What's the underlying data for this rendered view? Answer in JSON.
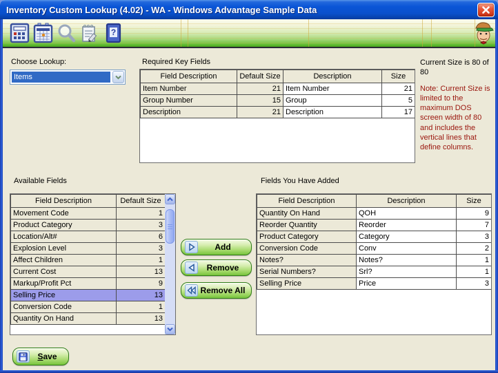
{
  "window": {
    "title": "Inventory Custom Lookup (4.02) - WA - Windows Advantage Sample Data"
  },
  "toolbar": {
    "icons": [
      "calculator",
      "calendar",
      "search",
      "notes",
      "help"
    ],
    "advisor": "advisor-character"
  },
  "lookup": {
    "label": "Choose Lookup:",
    "selected_value": "Items"
  },
  "required_fields": {
    "title": "Required Key Fields",
    "headers": [
      "Field Description",
      "Default Size",
      "Description",
      "Size"
    ],
    "rows": [
      [
        "Item Number",
        "21",
        "Item Number",
        "21"
      ],
      [
        "Group Number",
        "15",
        "Group",
        "5"
      ],
      [
        "Description",
        "21",
        "Description",
        "17"
      ]
    ]
  },
  "current_size": {
    "text": "Current Size is 80 of 80",
    "note": "Note:  Current Size is limited to the maximum DOS screen width of 80 and includes the vertical lines that define columns."
  },
  "available_fields": {
    "title": "Available Fields",
    "headers": [
      "Field Description",
      "Default Size"
    ],
    "rows": [
      [
        "Movement Code",
        "1"
      ],
      [
        "Product Category",
        "3"
      ],
      [
        "Location/Alt#",
        "6"
      ],
      [
        "Explosion Level",
        "3"
      ],
      [
        "Affect Children",
        "1"
      ],
      [
        "Current Cost",
        "13"
      ],
      [
        "Markup/Profit Pct",
        "9"
      ],
      [
        "Selling Price",
        "13"
      ],
      [
        "Conversion Code",
        "1"
      ],
      [
        "Quantity On Hand",
        "13"
      ]
    ],
    "selected_index": 7,
    "selected_row": "Selling Price"
  },
  "transfer": {
    "add_label": "Add",
    "remove_label": "Remove",
    "remove_all_label": "Remove All"
  },
  "added_fields": {
    "title": "Fields You Have Added",
    "headers": [
      "Field Description",
      "Description",
      "Size"
    ],
    "rows": [
      [
        "Quantity On Hand",
        "QOH",
        "9"
      ],
      [
        "Reorder Quantity",
        "Reorder",
        "7"
      ],
      [
        "Product Category",
        "Category",
        "3"
      ],
      [
        "Conversion Code",
        "Conv",
        "2"
      ],
      [
        "Notes?",
        "Notes?",
        "1"
      ],
      [
        "Serial Numbers?",
        "Srl?",
        "1"
      ],
      [
        "Selling Price",
        "Price",
        "3"
      ]
    ]
  },
  "save": {
    "label": "Save"
  },
  "colors": {
    "title_bar_blue": "#0a55d6",
    "toolbar_green": "#50af24",
    "background_beige": "#ece9d8",
    "selection_purple": "#9c9cea",
    "combo_selection_blue": "#316ac5",
    "note_red": "#9a150d",
    "button_green": "#78c43c"
  }
}
